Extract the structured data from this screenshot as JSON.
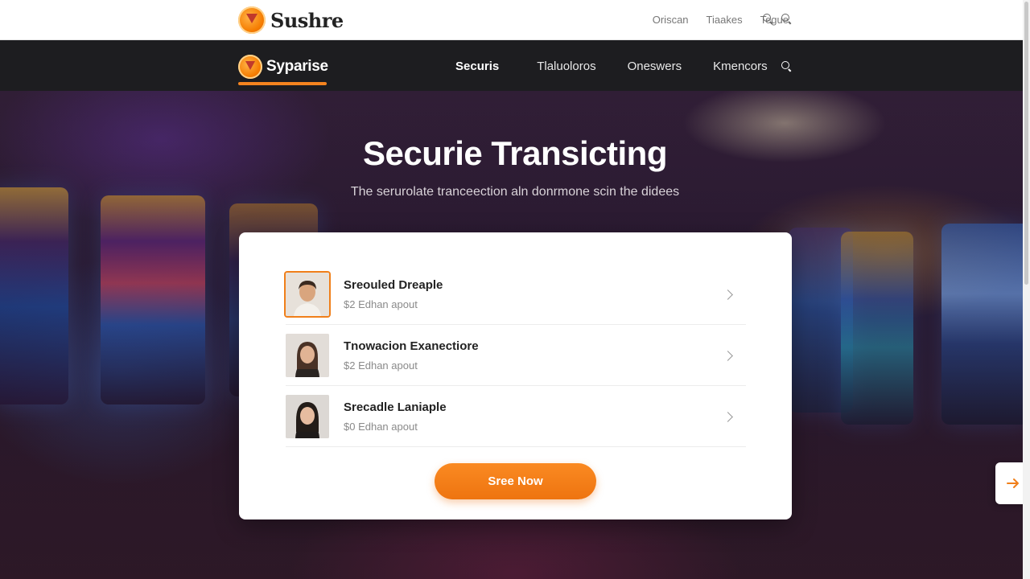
{
  "top_bar": {
    "brand": "Sushre",
    "links": [
      "Oriscan",
      "Tiaakes",
      "Tegue"
    ],
    "icons": [
      "search-icon",
      "search-icon"
    ]
  },
  "nav_bar": {
    "brand": "Syparise",
    "links": [
      "Securis",
      "Tlaluoloros",
      "Oneswers",
      "Kmencors"
    ],
    "active_link": "Securis",
    "icons": [
      "search-icon"
    ],
    "accent_color": "#f5841f"
  },
  "hero": {
    "title": "Securie Transicting",
    "subtitle": "The serurolate tranceection aln donrmone scin the didees"
  },
  "list": {
    "items": [
      {
        "name": "Sreouled Dreaple",
        "meta": "$2 Edhan apout",
        "selected": true
      },
      {
        "name": "Tnowacion Exanectiore",
        "meta": "$2 Edhan apout",
        "selected": false
      },
      {
        "name": "Srecadle Laniaple",
        "meta": "$0 Edhan apout",
        "selected": false
      }
    ]
  },
  "cta": {
    "label": "Sree Now",
    "color": "#f07f1a"
  },
  "side_tab": {
    "icon": "arrow-right-icon"
  }
}
